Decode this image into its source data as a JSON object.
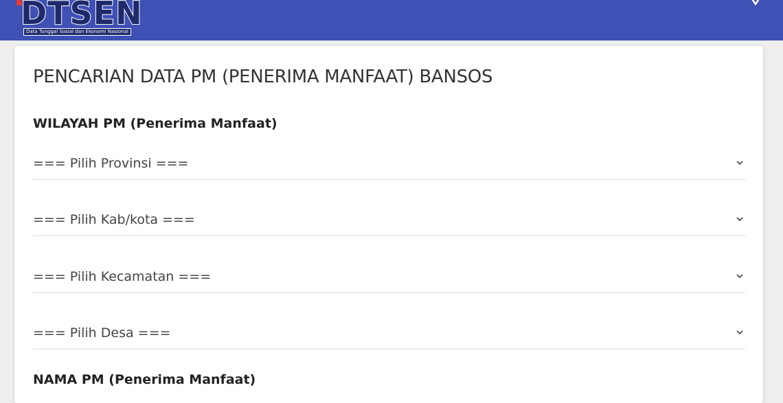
{
  "header": {
    "logo_text": "DTSEN",
    "logo_tagline": "Data Tunggal Sosial dan Ekonomi Nasional",
    "colors": {
      "bar": "#3f51b5",
      "logo_fill": "#1f2a6b",
      "logo_accent": "#e53935"
    },
    "close_icon": "close-icon"
  },
  "main": {
    "title": "PENCARIAN DATA PM (PENERIMA MANFAAT) BANSOS",
    "region_section": {
      "heading": "WILAYAH PM (Penerima Manfaat)",
      "selects": [
        {
          "label": "=== Pilih Provinsi ===",
          "icon": "chevron-down-icon"
        },
        {
          "label": "=== Pilih Kab/kota ===",
          "icon": "chevron-down-icon"
        },
        {
          "label": "=== Pilih Kecamatan ===",
          "icon": "chevron-down-icon"
        },
        {
          "label": "=== Pilih Desa ===",
          "icon": "chevron-down-icon"
        }
      ]
    },
    "name_section": {
      "heading": "NAMA PM (Penerima Manfaat)"
    }
  }
}
